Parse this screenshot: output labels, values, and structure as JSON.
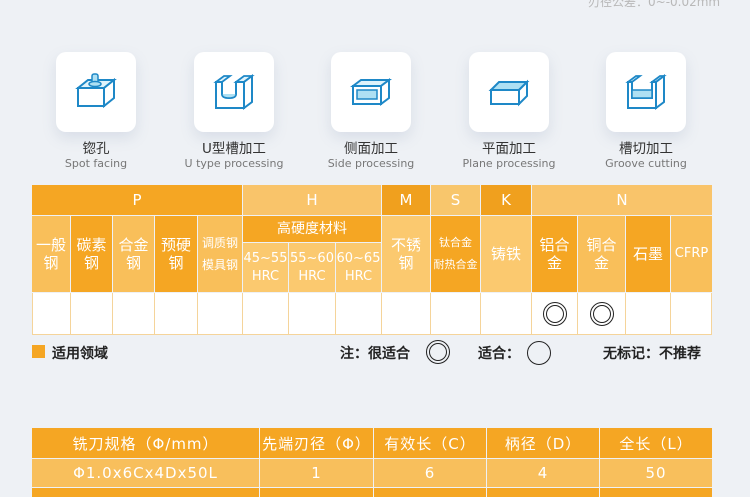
{
  "top_note": "刃径公差：0~-0.02mm",
  "processes": [
    {
      "cn": "锪孔",
      "en": "Spot facing",
      "icon": "spot-facing-icon"
    },
    {
      "cn": "U型槽加工",
      "en": "U type processing",
      "icon": "u-groove-icon"
    },
    {
      "cn": "侧面加工",
      "en": "Side processing",
      "icon": "side-processing-icon"
    },
    {
      "cn": "平面加工",
      "en": "Plane processing",
      "icon": "plane-processing-icon"
    },
    {
      "cn": "槽切加工",
      "en": "Groove cutting",
      "icon": "groove-cutting-icon"
    }
  ],
  "material_table": {
    "groups": {
      "p": "P",
      "h": "H",
      "m": "M",
      "s": "S",
      "k": "K",
      "n": "N"
    },
    "h_sub_title": "高硬度材料",
    "columns": {
      "c1": [
        "一般",
        "钢"
      ],
      "c2": [
        "碳素",
        "钢"
      ],
      "c3": [
        "合金",
        "钢"
      ],
      "c4": [
        "预硬",
        "钢"
      ],
      "c5": [
        "调质钢",
        "模具钢"
      ],
      "h1": [
        "45~55",
        "HRC"
      ],
      "h2": [
        "55~60",
        "HRC"
      ],
      "h3": [
        "60~65",
        "HRC"
      ],
      "m1": [
        "不锈",
        "钢"
      ],
      "s1": [
        "钛合金",
        "耐热合金"
      ],
      "k1": "铸铁",
      "n1": [
        "铝合",
        "金"
      ],
      "n2": [
        "铜合",
        "金"
      ],
      "n3": "石墨",
      "n4": "CFRP"
    }
  },
  "legend": {
    "applicable": "适用领域",
    "very_suitable": "注：很适合",
    "suitable": "适合：",
    "not_recommended": "无标记：不推荐"
  },
  "spec_table": {
    "headers": [
      "铣刀规格（Φ/mm）",
      "先端刃径（Φ）",
      "有效长（C）",
      "柄径（D）",
      "全长（L）"
    ],
    "rows": [
      [
        "Φ1.0x6Cx4Dx50L",
        "1",
        "6",
        "4",
        "50"
      ]
    ]
  },
  "colors": {
    "accent": "#f5a623",
    "light": "#f9c46a"
  }
}
